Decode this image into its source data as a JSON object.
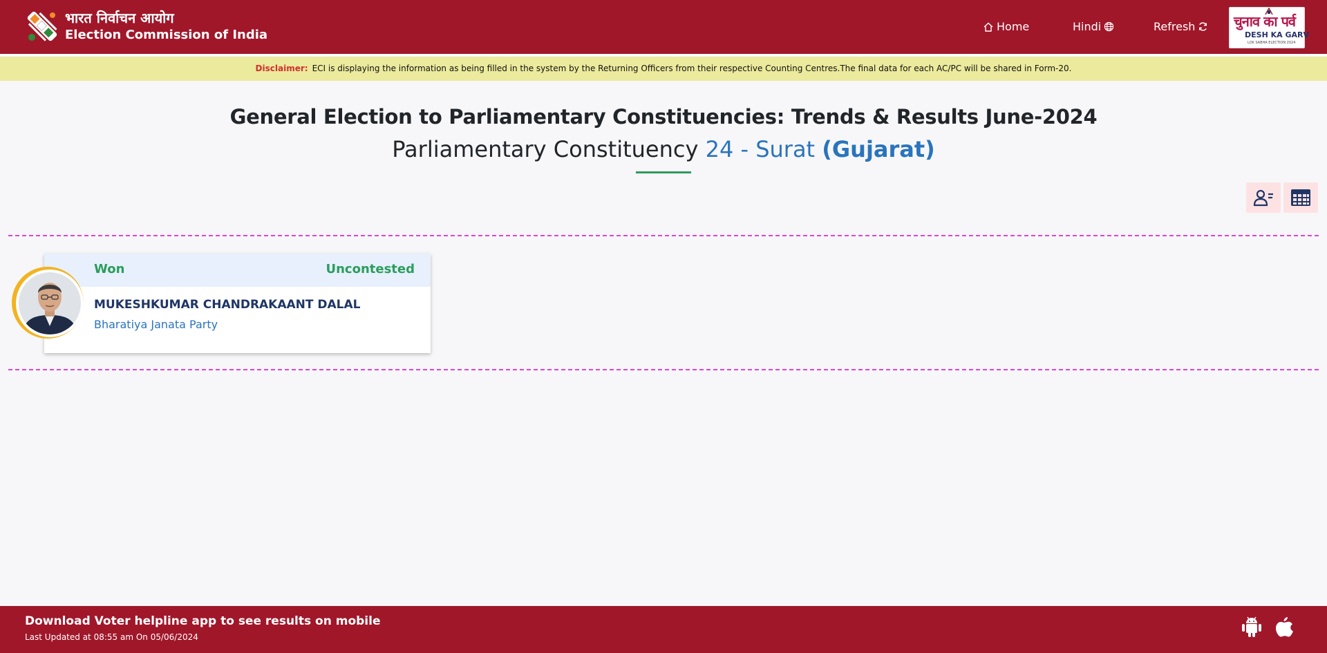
{
  "header": {
    "brand_hindi": "भारत निर्वाचन आयोग",
    "brand_english": "Election Commission of India",
    "nav": {
      "home": "Home",
      "hindi": "Hindi",
      "refresh": "Refresh"
    },
    "badge": {
      "hindi": "चुनाव का पर्व",
      "english": "DESH KA GARV",
      "small": "LOK SABHA ELECTION 2024"
    }
  },
  "disclaimer": {
    "label": "Disclaimer:",
    "text": "ECI is displaying the information as being filled in the system by the Returning Officers from their respective Counting Centres.The final data for each AC/PC will be shared in Form-20."
  },
  "title": {
    "line1": "General Election to Parliamentary Constituencies: Trends & Results June-2024",
    "line2_prefix": "Parliamentary Constituency",
    "constituency": "24 - Surat",
    "state": "(Gujarat)"
  },
  "candidate": {
    "status": "Won",
    "margin": "Uncontested",
    "name": "MUKESHKUMAR CHANDRAKAANT DALAL",
    "party": "Bharatiya Janata Party"
  },
  "footer": {
    "title": "Download Voter helpline app to see results on mobile",
    "updated": "Last Updated at 08:55 am On 05/06/2024"
  },
  "colors": {
    "primary": "#a0172a",
    "disclaimer_bg": "#ecea9c",
    "accent_blue": "#2a74bc",
    "won_green": "#2a9d5c",
    "dash_pink": "#e040e0",
    "ring_gold": "#f2b323"
  },
  "icons": [
    "eci-logo-icon",
    "home-icon",
    "globe-icon",
    "refresh-icon",
    "candidate-list-icon",
    "table-grid-icon",
    "android-icon",
    "apple-icon"
  ]
}
